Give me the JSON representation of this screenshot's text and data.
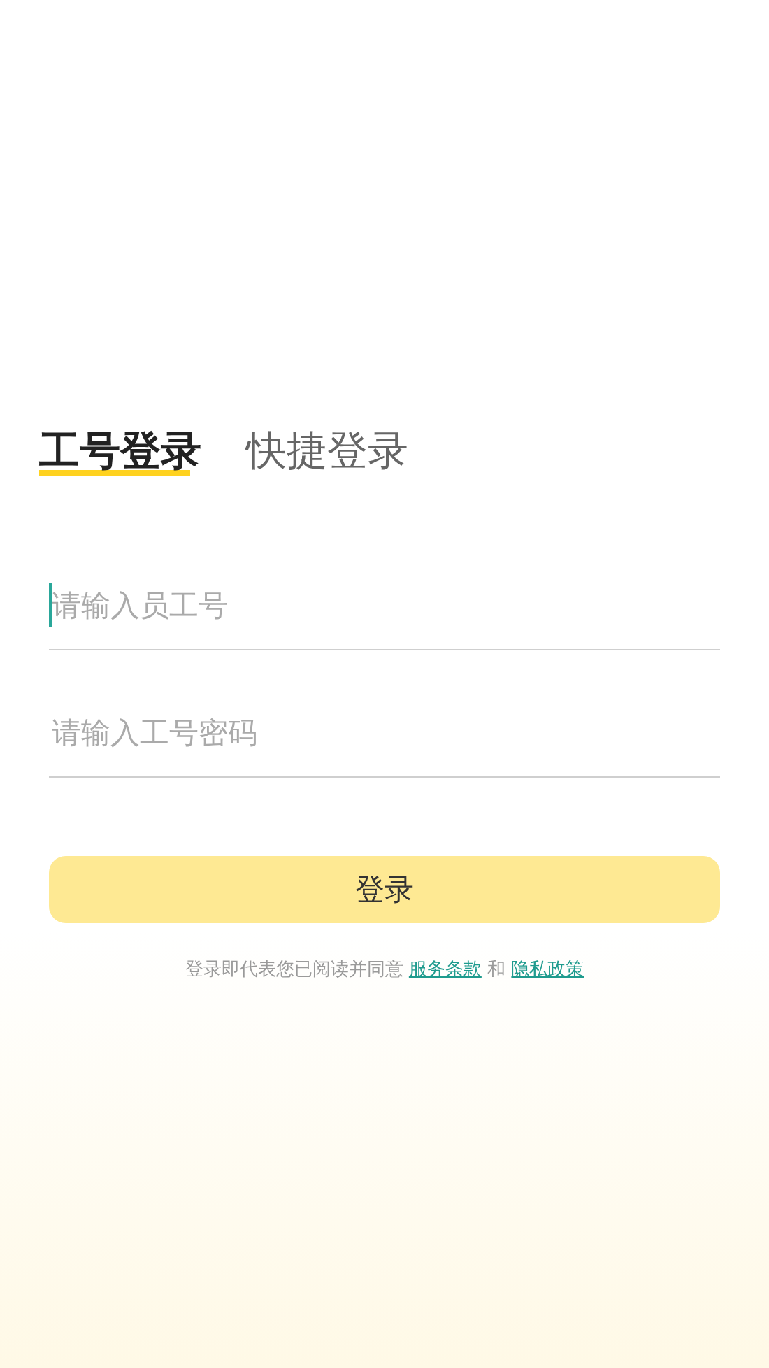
{
  "tabs": [
    {
      "label": "工号登录",
      "selected": true
    },
    {
      "label": "快捷登录",
      "selected": false
    }
  ],
  "fields": [
    {
      "placeholder": "请输入员工号",
      "focused": true
    },
    {
      "placeholder": "请输入工号密码",
      "focused": false
    }
  ],
  "login_button": {
    "label": "登录"
  },
  "agreement": [
    {
      "kind": "text",
      "text": "登录即代表您已阅读并同意"
    },
    {
      "kind": "link",
      "text": "服务条款"
    },
    {
      "kind": "text",
      "text": "和"
    },
    {
      "kind": "link",
      "text": "隐私政策"
    }
  ]
}
